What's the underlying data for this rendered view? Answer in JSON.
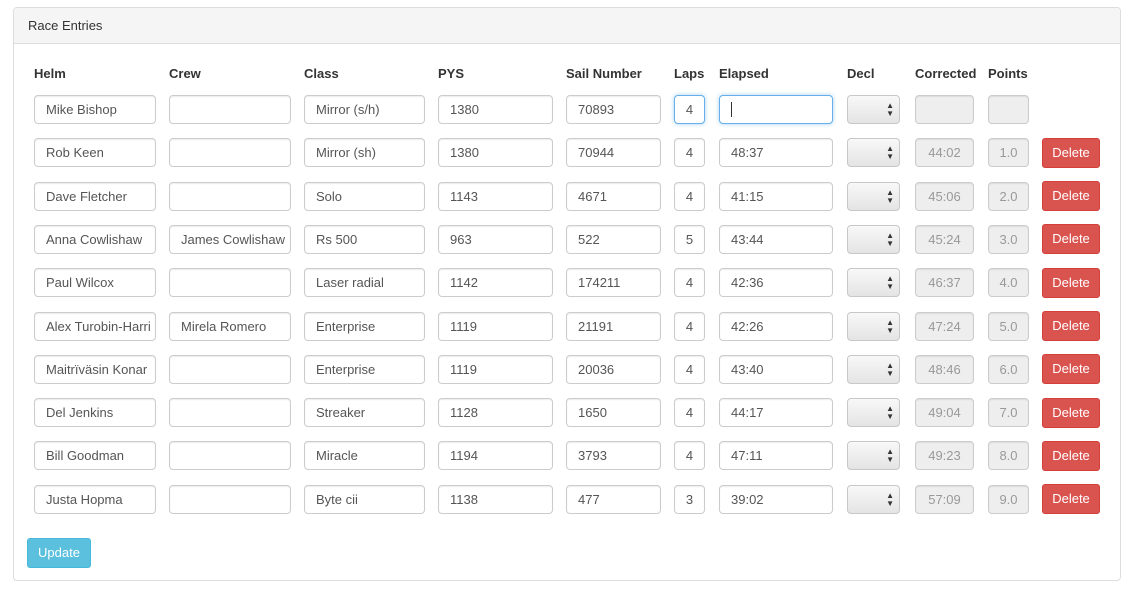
{
  "panel": {
    "title": "Race Entries"
  },
  "columns": {
    "helm": "Helm",
    "crew": "Crew",
    "class": "Class",
    "pys": "PYS",
    "sail": "Sail Number",
    "laps": "Laps",
    "elapsed": "Elapsed",
    "decl": "Decl",
    "corrected": "Corrected",
    "points": "Points"
  },
  "entries": [
    {
      "helm": "Mike Bishop",
      "crew": "",
      "class": "Mirror (s/h)",
      "pys": "1380",
      "sail": "70893",
      "laps": "4",
      "elapsed": "",
      "decl": "",
      "corrected": "",
      "points": "",
      "delete_label": ""
    },
    {
      "helm": "Rob Keen",
      "crew": "",
      "class": "Mirror (sh)",
      "pys": "1380",
      "sail": "70944",
      "laps": "4",
      "elapsed": "48:37",
      "decl": "",
      "corrected": "44:02",
      "points": "1.0",
      "delete_label": "Delete"
    },
    {
      "helm": "Dave Fletcher",
      "crew": "",
      "class": "Solo",
      "pys": "1143",
      "sail": "4671",
      "laps": "4",
      "elapsed": "41:15",
      "decl": "",
      "corrected": "45:06",
      "points": "2.0",
      "delete_label": "Delete"
    },
    {
      "helm": "Anna Cowlishaw",
      "crew": "James Cowlishaw",
      "class": "Rs 500",
      "pys": "963",
      "sail": "522",
      "laps": "5",
      "elapsed": "43:44",
      "decl": "",
      "corrected": "45:24",
      "points": "3.0",
      "delete_label": "Delete"
    },
    {
      "helm": "Paul Wilcox",
      "crew": "",
      "class": "Laser radial",
      "pys": "1142",
      "sail": "174211",
      "laps": "4",
      "elapsed": "42:36",
      "decl": "",
      "corrected": "46:37",
      "points": "4.0",
      "delete_label": "Delete"
    },
    {
      "helm": "Alex Turobin-Harri",
      "crew": "Mirela Romero",
      "class": "Enterprise",
      "pys": "1119",
      "sail": "21191",
      "laps": "4",
      "elapsed": "42:26",
      "decl": "",
      "corrected": "47:24",
      "points": "5.0",
      "delete_label": "Delete"
    },
    {
      "helm": "Maitrïväsin Konar",
      "crew": "",
      "class": "Enterprise",
      "pys": "1119",
      "sail": "20036",
      "laps": "4",
      "elapsed": "43:40",
      "decl": "",
      "corrected": "48:46",
      "points": "6.0",
      "delete_label": "Delete"
    },
    {
      "helm": "Del Jenkins",
      "crew": "",
      "class": "Streaker",
      "pys": "1128",
      "sail": "1650",
      "laps": "4",
      "elapsed": "44:17",
      "decl": "",
      "corrected": "49:04",
      "points": "7.0",
      "delete_label": "Delete"
    },
    {
      "helm": "Bill Goodman",
      "crew": "",
      "class": "Miracle",
      "pys": "1194",
      "sail": "3793",
      "laps": "4",
      "elapsed": "47:11",
      "decl": "",
      "corrected": "49:23",
      "points": "8.0",
      "delete_label": "Delete"
    },
    {
      "helm": "Justa Hopma",
      "crew": "",
      "class": "Byte cii",
      "pys": "1138",
      "sail": "477",
      "laps": "3",
      "elapsed": "39:02",
      "decl": "",
      "corrected": "57:09",
      "points": "9.0",
      "delete_label": "Delete"
    }
  ],
  "update_label": "Update",
  "icons": {
    "select_arrows": "updown-arrows-icon"
  },
  "colors": {
    "delete": "#d9534f",
    "update": "#5bc0de",
    "focus": "#66afe9"
  }
}
